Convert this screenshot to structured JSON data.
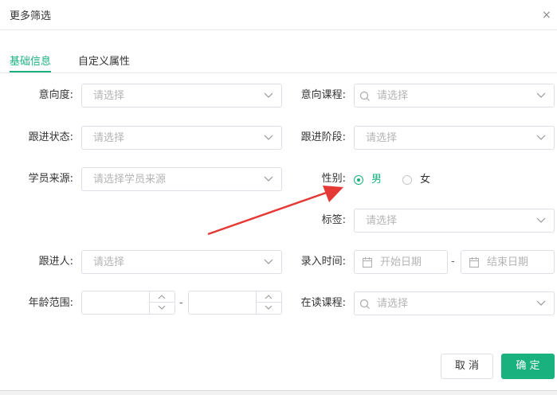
{
  "dialog": {
    "title": "更多筛选",
    "close_glyph": "×"
  },
  "tabs": [
    {
      "label": "基础信息",
      "active": true
    },
    {
      "label": "自定义属性",
      "active": false
    }
  ],
  "form": {
    "intent_level": {
      "label": "意向度:",
      "placeholder": "请选择"
    },
    "intent_course": {
      "label": "意向课程:",
      "placeholder": "请选择"
    },
    "follow_status": {
      "label": "跟进状态:",
      "placeholder": "请选择"
    },
    "follow_stage": {
      "label": "跟进阶段:",
      "placeholder": "请选择"
    },
    "student_source": {
      "label": "学员来源:",
      "placeholder": "请选择学员来源"
    },
    "gender": {
      "label": "性别:",
      "options": [
        {
          "label": "男",
          "selected": true
        },
        {
          "label": "女",
          "selected": false
        }
      ]
    },
    "tags": {
      "label": "标签:",
      "placeholder": "请选择"
    },
    "follower": {
      "label": "跟进人:",
      "placeholder": "请选择"
    },
    "entry_time": {
      "label": "录入时间:",
      "start_placeholder": "开始日期",
      "end_placeholder": "结束日期",
      "separator": "-"
    },
    "age_range": {
      "label": "年龄范围:",
      "min_value": "",
      "max_value": "",
      "separator": "-"
    },
    "current_course": {
      "label": "在读课程:",
      "placeholder": "请选择"
    }
  },
  "footer": {
    "cancel_label": "取 消",
    "confirm_label": "确 定"
  },
  "colors": {
    "accent": "#19b27f",
    "annotation_arrow": "#e53935",
    "border": "#dcdfe6",
    "placeholder": "#b4b4b4"
  },
  "icons": [
    "close-icon",
    "chevron-down-icon",
    "search-icon",
    "calendar-icon",
    "caret-up-icon",
    "caret-down-icon"
  ]
}
